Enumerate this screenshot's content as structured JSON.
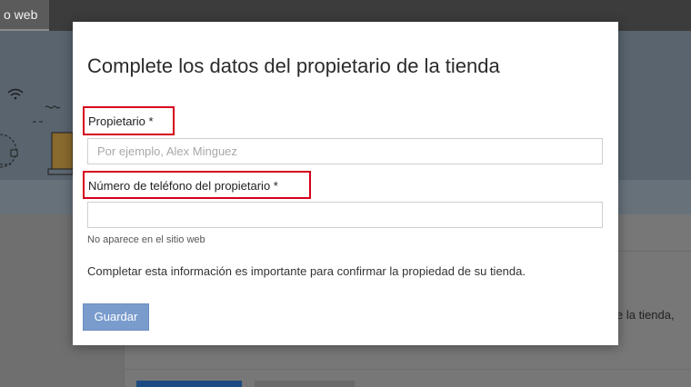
{
  "background": {
    "tab_label": "o web",
    "partial_text": "e la tienda,"
  },
  "modal": {
    "title": "Complete los datos del propietario de la tienda",
    "owner_field": {
      "label": "Propietario *",
      "placeholder": "Por ejemplo, Alex Minguez",
      "value": ""
    },
    "phone_field": {
      "label": "Número de teléfono del propietario *",
      "placeholder": "",
      "value": "",
      "help": "No aparece en el sitio web"
    },
    "info_text": "Completar esta información es importante para confirmar la propiedad de su tienda.",
    "save_label": "Guardar"
  },
  "colors": {
    "highlight_border": "#d6001c",
    "save_button": "#7a9ccd"
  }
}
